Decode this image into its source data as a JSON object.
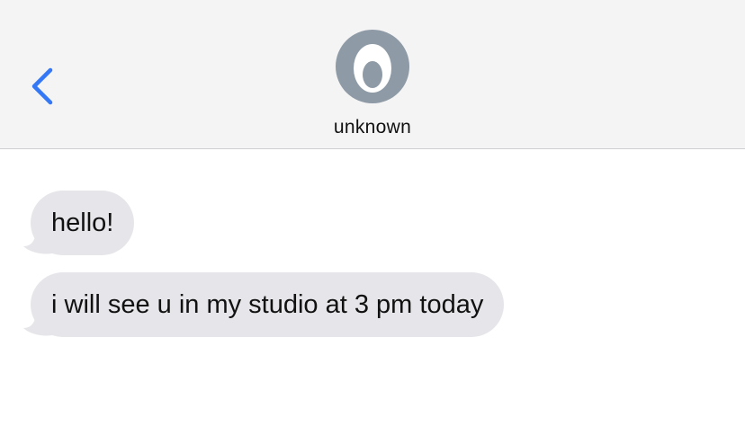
{
  "header": {
    "back_icon": "chevron-left-icon",
    "accent_color": "#3478f6",
    "avatar_icon": "contact-placeholder-icon",
    "contact_name": "unknown"
  },
  "messages": [
    {
      "direction": "incoming",
      "text": "hello!"
    },
    {
      "direction": "incoming",
      "text": "i will see u in my studio at 3 pm today"
    }
  ],
  "colors": {
    "incoming_bubble": "#e6e6ea",
    "header_background": "#f4f4f4",
    "avatar_background": "#8e9aa6"
  }
}
